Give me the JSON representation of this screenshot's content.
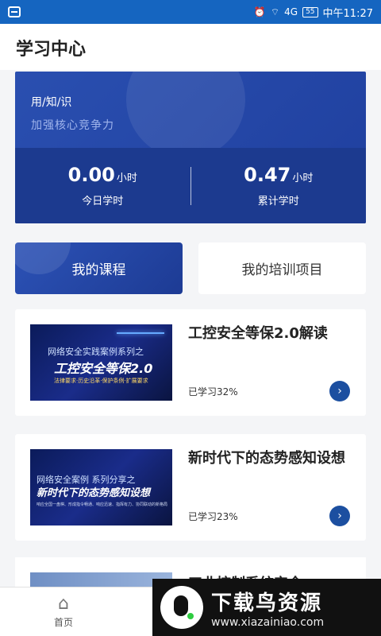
{
  "statusbar": {
    "signal": "4G",
    "battery": "55",
    "time": "中午11:27"
  },
  "header": {
    "title": "学习中心"
  },
  "banner": {
    "topline": "用/知/识",
    "subtitle": "加强核心竞争力",
    "today": {
      "value": "0.00",
      "unit": "小时",
      "label": "今日学时"
    },
    "total": {
      "value": "0.47",
      "unit": "小时",
      "label": "累计学时"
    }
  },
  "tabs": {
    "active": "我的课程",
    "inactive": "我的培训项目"
  },
  "courses": [
    {
      "title": "工控安全等保2.0解读",
      "progress": "已学习32%",
      "thumb": {
        "line1": "网络安全实践案例系列之",
        "line2": "工控安全等保2.0",
        "line3": "法律要求·历史沿革·保护条例·扩展要求"
      }
    },
    {
      "title": "新时代下的态势感知设想",
      "progress": "已学习23%",
      "thumb": {
        "line1": "网络安全案例 系列分享之",
        "line2": "新时代下的态势感知设想",
        "line3": "响应全国一盘棋、形成指令畅通、响应迅速、指挥有力、协同联动的新格局"
      }
    },
    {
      "title": "工业控制系统安全"
    }
  ],
  "nav": {
    "home": "首页"
  },
  "watermark": {
    "name": "下载鸟资源",
    "url": "www.xiazainiao.com"
  }
}
